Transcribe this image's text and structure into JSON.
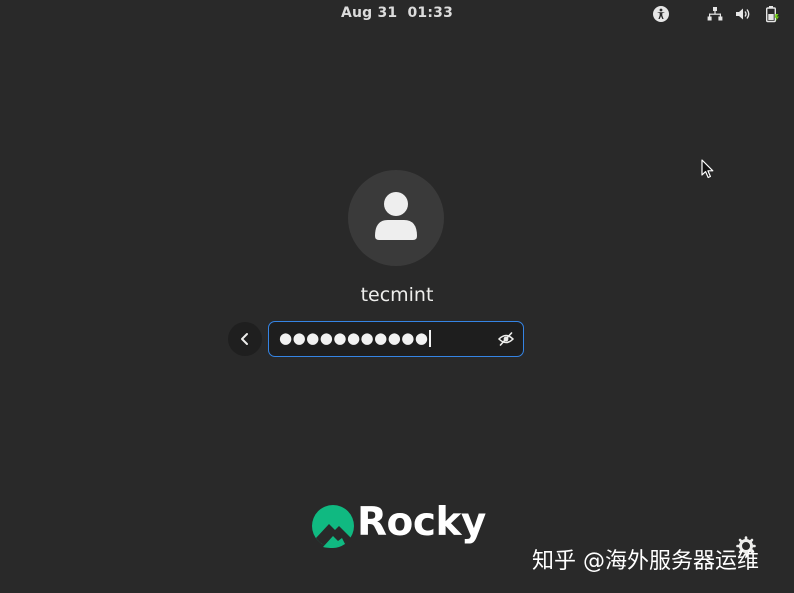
{
  "topbar": {
    "clock": "Aug 31  01:33",
    "icons": [
      "accessibility-icon",
      "network-wired-icon",
      "volume-icon",
      "battery-icon"
    ]
  },
  "login": {
    "username": "tecmint",
    "password_masked": "●●●●●●●●●●●",
    "accent_color": "#3584e4"
  },
  "branding": {
    "logo_text": "Rocky",
    "logo_color": "#10b981"
  },
  "watermark": {
    "text": "知乎 @海外服务器运维"
  }
}
